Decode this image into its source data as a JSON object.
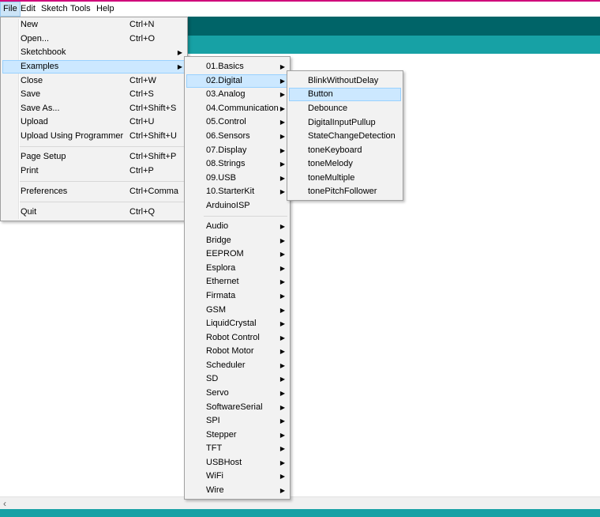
{
  "menubar": [
    "File",
    "Edit",
    "Sketch",
    "Tools",
    "Help"
  ],
  "file_menu": [
    {
      "label": "New",
      "shortcut": "Ctrl+N"
    },
    {
      "label": "Open...",
      "shortcut": "Ctrl+O"
    },
    {
      "label": "Sketchbook",
      "shortcut": ""
    },
    {
      "label": "Examples",
      "shortcut": ""
    },
    {
      "label": "Close",
      "shortcut": "Ctrl+W"
    },
    {
      "label": "Save",
      "shortcut": "Ctrl+S"
    },
    {
      "label": "Save As...",
      "shortcut": "Ctrl+Shift+S"
    },
    {
      "label": "Upload",
      "shortcut": "Ctrl+U"
    },
    {
      "label": "Upload Using Programmer",
      "shortcut": "Ctrl+Shift+U"
    },
    {
      "label": "Page Setup",
      "shortcut": "Ctrl+Shift+P"
    },
    {
      "label": "Print",
      "shortcut": "Ctrl+P"
    },
    {
      "label": "Preferences",
      "shortcut": "Ctrl+Comma"
    },
    {
      "label": "Quit",
      "shortcut": "Ctrl+Q"
    }
  ],
  "examples_menu": [
    "01.Basics",
    "02.Digital",
    "03.Analog",
    "04.Communication",
    "05.Control",
    "06.Sensors",
    "07.Display",
    "08.Strings",
    "09.USB",
    "10.StarterKit",
    "ArduinoISP",
    "Audio",
    "Bridge",
    "EEPROM",
    "Esplora",
    "Ethernet",
    "Firmata",
    "GSM",
    "LiquidCrystal",
    "Robot Control",
    "Robot Motor",
    "Scheduler",
    "SD",
    "Servo",
    "SoftwareSerial",
    "SPI",
    "Stepper",
    "TFT",
    "USBHost",
    "WiFi",
    "Wire"
  ],
  "digital_menu": [
    "BlinkWithoutDelay",
    "Button",
    "Debounce",
    "DigitalInputPullup",
    "StateChangeDetection",
    "toneKeyboard",
    "toneMelody",
    "toneMultiple",
    "tonePitchFollower"
  ],
  "scroll": {
    "left_arrow": "‹"
  },
  "colors": {
    "toolbar": "#006468",
    "tabstrip": "#17a1a5",
    "highlight": "#cce8ff"
  }
}
